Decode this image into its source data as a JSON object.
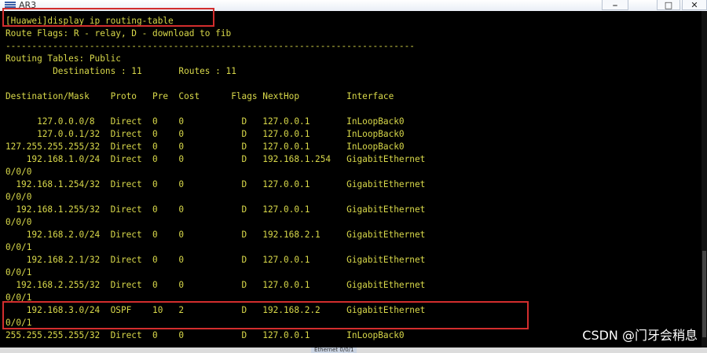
{
  "window": {
    "title": "AR3",
    "controls": [
      "⎯",
      "□",
      "✕"
    ]
  },
  "terminal": {
    "lines": [
      "[Huawei]display ip routing-table",
      "Route Flags: R - relay, D - download to fib",
      "------------------------------------------------------------------------------",
      "Routing Tables: Public",
      "         Destinations : 11       Routes : 11",
      "",
      "Destination/Mask    Proto   Pre  Cost      Flags NextHop         Interface",
      "",
      "      127.0.0.0/8   Direct  0    0           D   127.0.0.1       InLoopBack0",
      "      127.0.0.1/32  Direct  0    0           D   127.0.0.1       InLoopBack0",
      "127.255.255.255/32  Direct  0    0           D   127.0.0.1       InLoopBack0",
      "    192.168.1.0/24  Direct  0    0           D   192.168.1.254   GigabitEthernet",
      "0/0/0",
      "  192.168.1.254/32  Direct  0    0           D   127.0.0.1       GigabitEthernet",
      "0/0/0",
      "  192.168.1.255/32  Direct  0    0           D   127.0.0.1       GigabitEthernet",
      "0/0/0",
      "    192.168.2.0/24  Direct  0    0           D   192.168.2.1     GigabitEthernet",
      "0/0/1",
      "    192.168.2.1/32  Direct  0    0           D   127.0.0.1       GigabitEthernet",
      "0/0/1",
      "  192.168.2.255/32  Direct  0    0           D   127.0.0.1       GigabitEthernet",
      "0/0/1",
      "    192.168.3.0/24  OSPF    10   2           D   192.168.2.2     GigabitEthernet",
      "0/0/1",
      "255.255.255.255/32  Direct  0    0           D   127.0.0.1       InLoopBack0"
    ]
  },
  "watermark": "CSDN @门牙会稍息",
  "status_tab": "Ethernet 0/0/1",
  "colors": {
    "text": "#d9d94a",
    "background": "#000000",
    "highlight": "#d22d2d"
  }
}
